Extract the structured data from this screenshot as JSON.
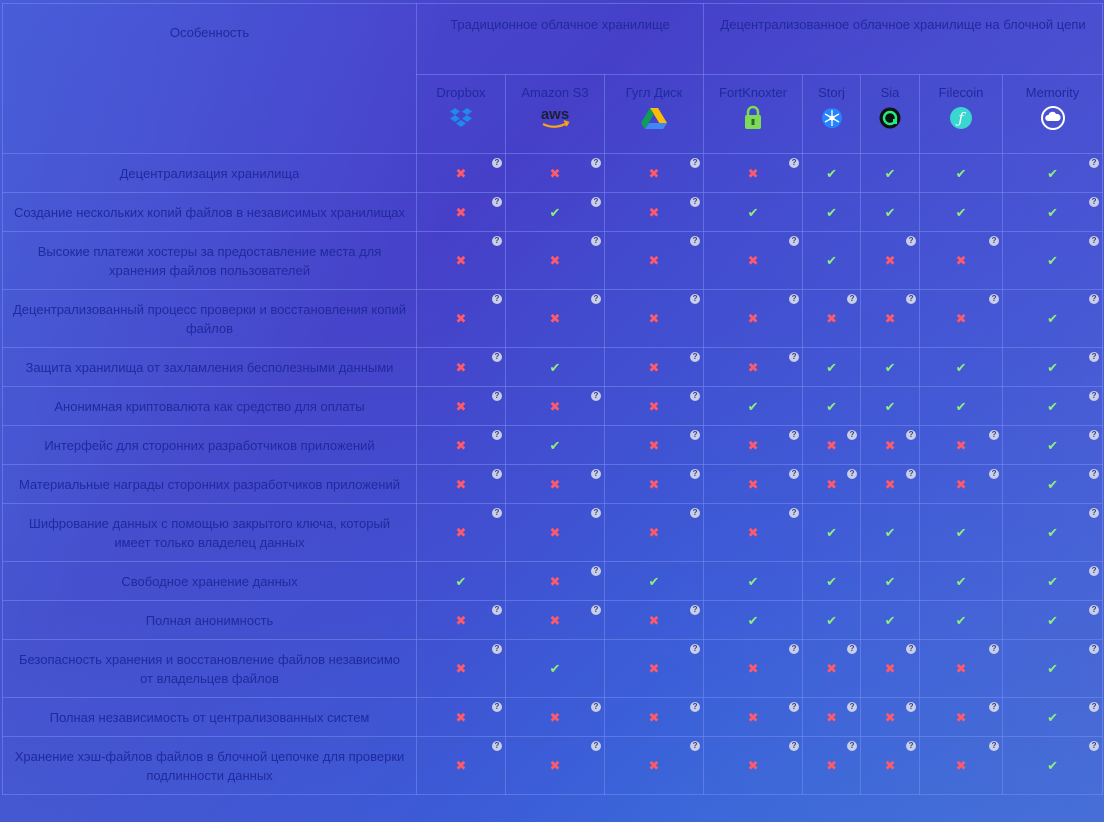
{
  "header": {
    "feature": "Особенность",
    "traditional": "Традиционное облачное хранилище",
    "decentralized": "Децентрализованное облачное хранилище на блочной цепи"
  },
  "providers": [
    {
      "name": "Dropbox",
      "icon": "dropbox-icon"
    },
    {
      "name": "Amazon S3",
      "icon": "aws-icon"
    },
    {
      "name": "Гугл Диск",
      "icon": "google-drive-icon"
    },
    {
      "name": "FortKnoxter",
      "icon": "fortknoxter-lock-icon"
    },
    {
      "name": "Storj",
      "icon": "storj-icon"
    },
    {
      "name": "Sia",
      "icon": "sia-icon"
    },
    {
      "name": "Filecoin",
      "icon": "filecoin-icon"
    },
    {
      "name": "Memority",
      "icon": "memority-cloud-icon"
    }
  ],
  "icons": {
    "aws_text": "aws",
    "filecoin_glyph": "ƒ"
  },
  "rows": [
    {
      "feature": "Децентрализация хранилища",
      "values": [
        "no",
        "no",
        "no",
        "no",
        "yes",
        "yes",
        "yes",
        "yes"
      ],
      "help": [
        1,
        1,
        1,
        1,
        0,
        0,
        0,
        1
      ]
    },
    {
      "feature": "Создание нескольких копий файлов в независимых хранилищах",
      "values": [
        "no",
        "yes",
        "no",
        "yes",
        "yes",
        "yes",
        "yes",
        "yes"
      ],
      "help": [
        1,
        1,
        1,
        0,
        0,
        0,
        0,
        1
      ]
    },
    {
      "feature": "Высокие платежи хостеры за предоставление места для хранения файлов пользователей",
      "values": [
        "no",
        "no",
        "no",
        "no",
        "yes",
        "no",
        "no",
        "yes"
      ],
      "help": [
        1,
        1,
        1,
        1,
        0,
        1,
        1,
        1
      ]
    },
    {
      "feature": "Децентрализованный процесс проверки и восстановления копий файлов",
      "values": [
        "no",
        "no",
        "no",
        "no",
        "no",
        "no",
        "no",
        "yes"
      ],
      "help": [
        1,
        1,
        1,
        1,
        1,
        1,
        1,
        1
      ]
    },
    {
      "feature": "Защита хранилища от захламления бесполезными данными",
      "values": [
        "no",
        "yes",
        "no",
        "no",
        "yes",
        "yes",
        "yes",
        "yes"
      ],
      "help": [
        1,
        0,
        1,
        1,
        0,
        0,
        0,
        1
      ]
    },
    {
      "feature": "Анонимная криптовалюта как средство для оплаты",
      "values": [
        "no",
        "no",
        "no",
        "yes",
        "yes",
        "yes",
        "yes",
        "yes"
      ],
      "help": [
        1,
        1,
        1,
        0,
        0,
        0,
        0,
        1
      ]
    },
    {
      "feature": "Интерфейс для сторонних разработчиков приложений",
      "values": [
        "no",
        "yes",
        "no",
        "no",
        "no",
        "no",
        "no",
        "yes"
      ],
      "help": [
        1,
        0,
        1,
        1,
        1,
        1,
        1,
        1
      ]
    },
    {
      "feature": "Материальные награды сторонних разработчиков приложений",
      "values": [
        "no",
        "no",
        "no",
        "no",
        "no",
        "no",
        "no",
        "yes"
      ],
      "help": [
        1,
        1,
        1,
        1,
        1,
        1,
        1,
        1
      ]
    },
    {
      "feature": "Шифрование данных с помощью закрытого ключа, который имеет только владелец данных",
      "values": [
        "no",
        "no",
        "no",
        "no",
        "yes",
        "yes",
        "yes",
        "yes"
      ],
      "help": [
        1,
        1,
        1,
        1,
        0,
        0,
        0,
        1
      ]
    },
    {
      "feature": "Свободное хранение данных",
      "values": [
        "yes",
        "no",
        "yes",
        "yes",
        "yes",
        "yes",
        "yes",
        "yes"
      ],
      "help": [
        0,
        1,
        0,
        0,
        0,
        0,
        0,
        1
      ]
    },
    {
      "feature": "Полная анонимность",
      "values": [
        "no",
        "no",
        "no",
        "yes",
        "yes",
        "yes",
        "yes",
        "yes"
      ],
      "help": [
        1,
        1,
        1,
        0,
        0,
        0,
        0,
        1
      ]
    },
    {
      "feature": "Безопасность хранения и восстановление файлов независимо от владельцев файлов",
      "values": [
        "no",
        "yes",
        "no",
        "no",
        "no",
        "no",
        "no",
        "yes"
      ],
      "help": [
        1,
        0,
        1,
        1,
        1,
        1,
        1,
        1
      ]
    },
    {
      "feature": "Полная независимость от централизованных систем",
      "values": [
        "no",
        "no",
        "no",
        "no",
        "no",
        "no",
        "no",
        "yes"
      ],
      "help": [
        1,
        1,
        1,
        1,
        1,
        1,
        1,
        1
      ]
    },
    {
      "feature": "Хранение хэш-файлов файлов в блочной цепочке для проверки подлинности данных",
      "values": [
        "no",
        "no",
        "no",
        "no",
        "no",
        "no",
        "no",
        "yes"
      ],
      "help": [
        1,
        1,
        1,
        1,
        1,
        1,
        1,
        1
      ]
    }
  ],
  "marks": {
    "yes": "✔",
    "no": "✖",
    "help": "?"
  },
  "colors": {
    "yes": "#8ef07a",
    "no": "#ff5a6a",
    "text": "#1f2a9e"
  }
}
